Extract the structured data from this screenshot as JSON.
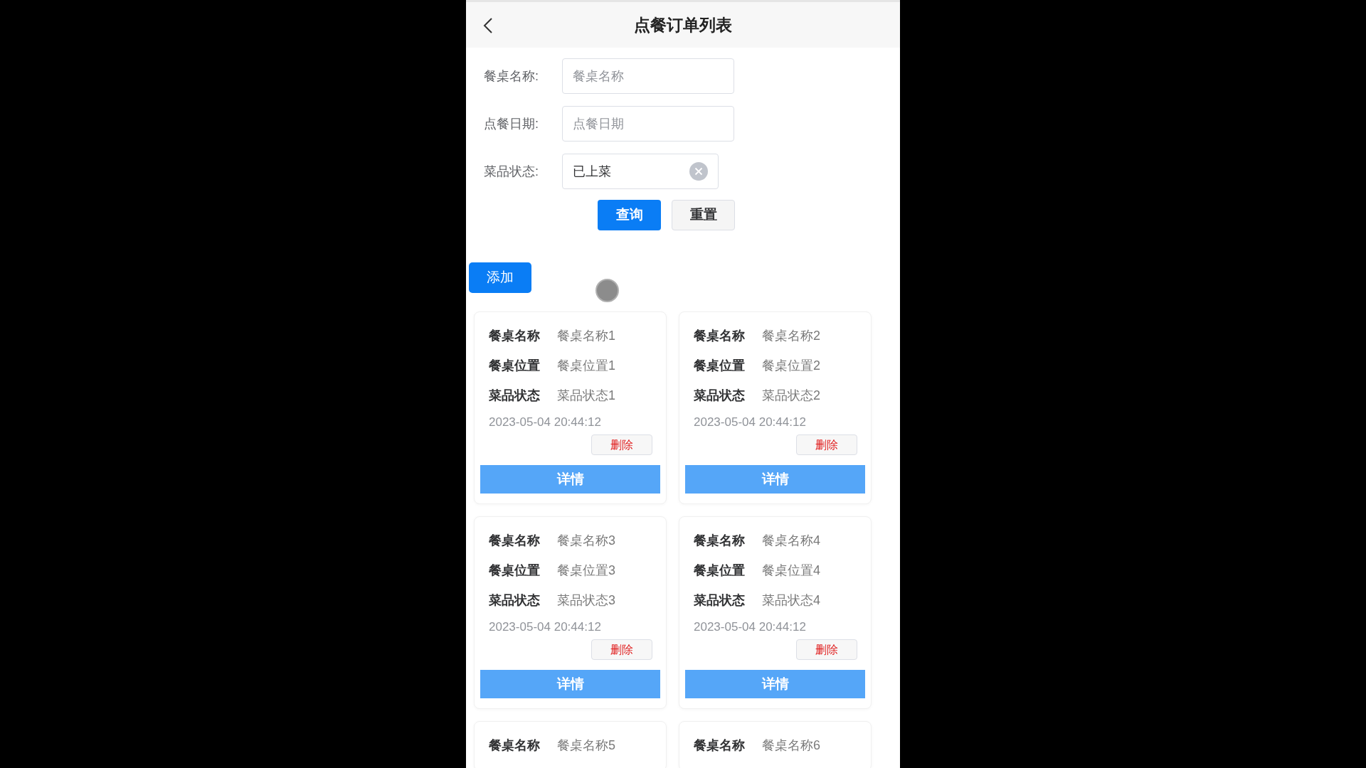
{
  "header": {
    "title": "点餐订单列表"
  },
  "filters": [
    {
      "kind": "input",
      "label": "餐桌名称:",
      "placeholder": "餐桌名称"
    },
    {
      "kind": "input",
      "label": "点餐日期:",
      "placeholder": "点餐日期"
    },
    {
      "kind": "select",
      "label": "菜品状态:",
      "value": "已上菜"
    }
  ],
  "buttons": {
    "search": "查询",
    "reset": "重置",
    "add": "添加"
  },
  "cards": [
    {
      "rows": [
        {
          "label": "餐桌名称",
          "value": "餐桌名称1"
        },
        {
          "label": "餐桌位置",
          "value": "餐桌位置1"
        },
        {
          "label": "菜品状态",
          "value": "菜品状态1"
        }
      ],
      "date": "2023-05-04 20:44:12",
      "delete": "删除",
      "detail": "详情"
    },
    {
      "rows": [
        {
          "label": "餐桌名称",
          "value": "餐桌名称2"
        },
        {
          "label": "餐桌位置",
          "value": "餐桌位置2"
        },
        {
          "label": "菜品状态",
          "value": "菜品状态2"
        }
      ],
      "date": "2023-05-04 20:44:12",
      "delete": "删除",
      "detail": "详情"
    },
    {
      "rows": [
        {
          "label": "餐桌名称",
          "value": "餐桌名称3"
        },
        {
          "label": "餐桌位置",
          "value": "餐桌位置3"
        },
        {
          "label": "菜品状态",
          "value": "菜品状态3"
        }
      ],
      "date": "2023-05-04 20:44:12",
      "delete": "删除",
      "detail": "详情"
    },
    {
      "rows": [
        {
          "label": "餐桌名称",
          "value": "餐桌名称4"
        },
        {
          "label": "餐桌位置",
          "value": "餐桌位置4"
        },
        {
          "label": "菜品状态",
          "value": "菜品状态4"
        }
      ],
      "date": "2023-05-04 20:44:12",
      "delete": "删除",
      "detail": "详情"
    },
    {
      "rows": [
        {
          "label": "餐桌名称",
          "value": "餐桌名称5"
        }
      ]
    },
    {
      "rows": [
        {
          "label": "餐桌名称",
          "value": "餐桌名称6"
        }
      ]
    }
  ]
}
